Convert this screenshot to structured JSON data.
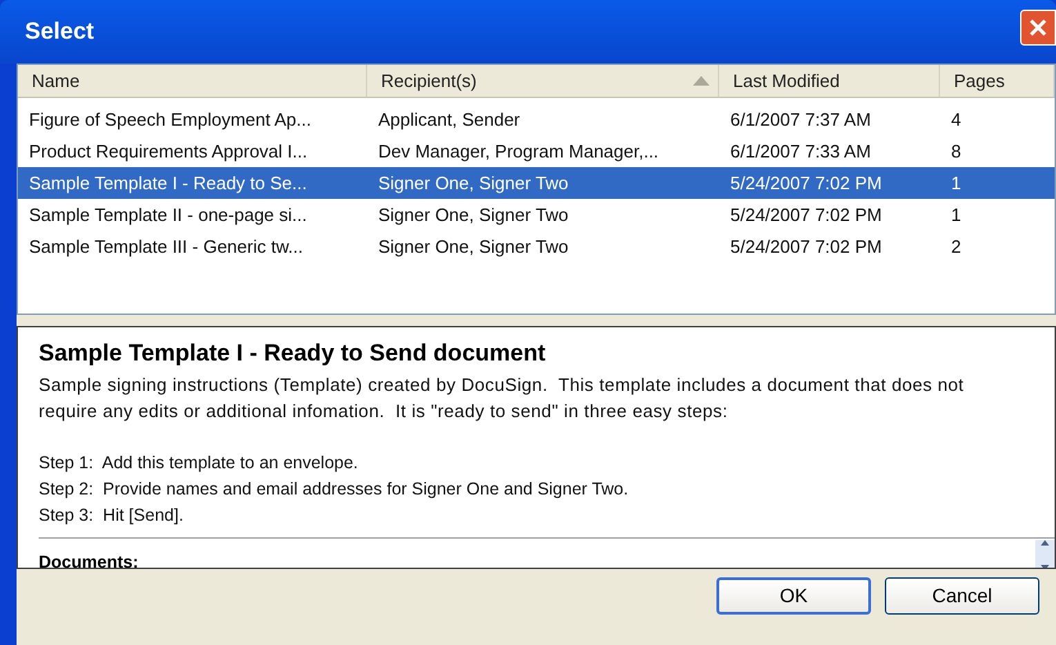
{
  "window": {
    "title": "Select"
  },
  "table": {
    "columns": [
      {
        "label": "Name",
        "sorted": false
      },
      {
        "label": "Recipient(s)",
        "sorted": true
      },
      {
        "label": "Last Modified",
        "sorted": false
      },
      {
        "label": "Pages",
        "sorted": false
      }
    ],
    "rows": [
      {
        "cells": [
          "Figure of Speech Employment Ap...",
          "Applicant, Sender",
          "6/1/2007 7:37 AM",
          "4"
        ],
        "selected": false
      },
      {
        "cells": [
          "Product Requirements Approval I...",
          "Dev Manager, Program Manager,...",
          "6/1/2007 7:33 AM",
          "8"
        ],
        "selected": false
      },
      {
        "cells": [
          "Sample Template I - Ready to Se...",
          "Signer One, Signer Two",
          "5/24/2007 7:02 PM",
          "1"
        ],
        "selected": true
      },
      {
        "cells": [
          "Sample Template II - one-page si...",
          "Signer One, Signer Two",
          "5/24/2007 7:02 PM",
          "1"
        ],
        "selected": false
      },
      {
        "cells": [
          "Sample Template III - Generic tw...",
          "Signer One, Signer Two",
          "5/24/2007 7:02 PM",
          "2"
        ],
        "selected": false
      }
    ]
  },
  "details": {
    "title": "Sample Template I - Ready to Send document",
    "description": "Sample signing instructions (Template) created by DocuSign.  This template includes a document that does not require any edits or additional infomation.  It is \"ready to send\" in three easy steps:",
    "steps": [
      "Step 1:  Add this template to an envelope.",
      "Step 2:  Provide names and email addresses for Signer One and Signer Two.",
      "Step 3:  Hit [Send]."
    ],
    "section": "Documents:"
  },
  "buttons": [
    {
      "label": "OK",
      "default": true
    },
    {
      "label": "Cancel",
      "default": false
    }
  ]
}
